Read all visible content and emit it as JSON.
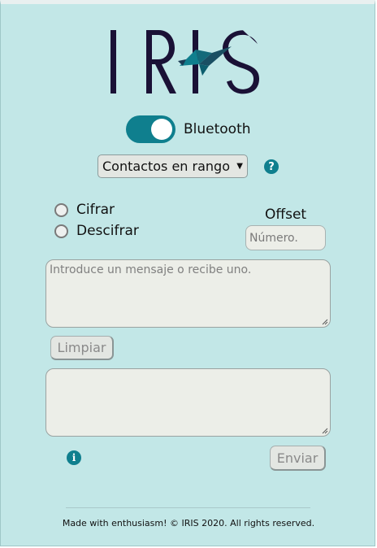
{
  "app": {
    "logo_text": "IRIS",
    "accent_color": "#0f7f8e",
    "background_color": "#c2e7e7"
  },
  "bluetooth": {
    "label": "Bluetooth",
    "enabled": true
  },
  "contacts": {
    "selected": "Contactos en rango",
    "help_icon": "question-circle-icon"
  },
  "mode": {
    "options": [
      "Cifrar",
      "Descifrar"
    ],
    "selected": null
  },
  "offset": {
    "label": "Offset",
    "placeholder": "Número."
  },
  "message": {
    "placeholder": "Introduce un mensaje o recibe uno.",
    "value": ""
  },
  "buttons": {
    "clear": "Limpiar",
    "send": "Enviar"
  },
  "output": {
    "value": ""
  },
  "info_icon": "info-circle-icon",
  "footer": {
    "text": "Made with enthusiasm! © IRIS 2020. All rights reserved."
  }
}
